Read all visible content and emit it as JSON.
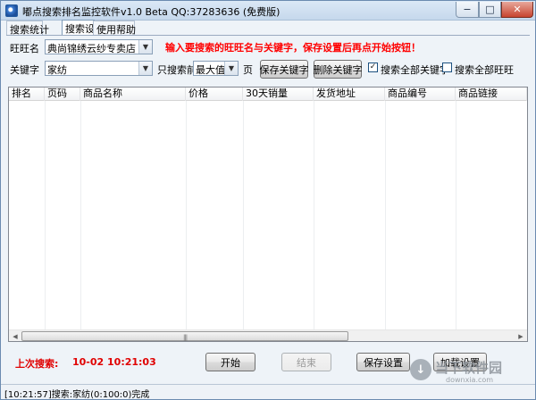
{
  "window": {
    "title": "嘟点搜索排名监控软件v1.0 Beta QQ:37283636 (免费版)",
    "controls": {
      "minimize": "−",
      "maximize": "□",
      "close": "✕"
    }
  },
  "tabs": [
    "搜索统计",
    "搜索设置",
    "使用帮助"
  ],
  "form": {
    "wangwang_label": "旺旺名",
    "wangwang_value": "典尚锦绣云纱专卖店",
    "keyword_label": "关键字",
    "keyword_value": "家纺",
    "hint": "输入要搜索的旺旺名与关键字，保存设置后再点开始按钮！",
    "search_front_label": "只搜索前",
    "search_front_value": "最大值",
    "page_label": "页",
    "save_keyword_button": "保存关键字",
    "delete_keyword_button": "删除关键字",
    "search_all_keywords_label": "搜索全部关键字",
    "search_all_keywords_checked": true,
    "search_all_wangwang_label": "搜索全部旺旺",
    "search_all_wangwang_checked": false
  },
  "table": {
    "columns": [
      "排名",
      "页码",
      "商品名称",
      "价格",
      "30天销量",
      "发货地址",
      "商品编号",
      "商品链接"
    ],
    "rows": []
  },
  "footer": {
    "last_search_label": "上次搜索:",
    "last_search_time": "10-02 10:21:03",
    "start_button": "开始",
    "stop_button": "结束",
    "save_settings_button": "保存设置",
    "load_settings_button": "加载设置"
  },
  "status_bar": "[10:21:57]搜索:家纺(0:100:0)完成",
  "watermark": {
    "title": "当下软件园",
    "url": "downxia.com"
  },
  "colors": {
    "hint_red": "#ff0000",
    "title_bar": "#c6d8ec",
    "close_red": "#c7442f"
  }
}
